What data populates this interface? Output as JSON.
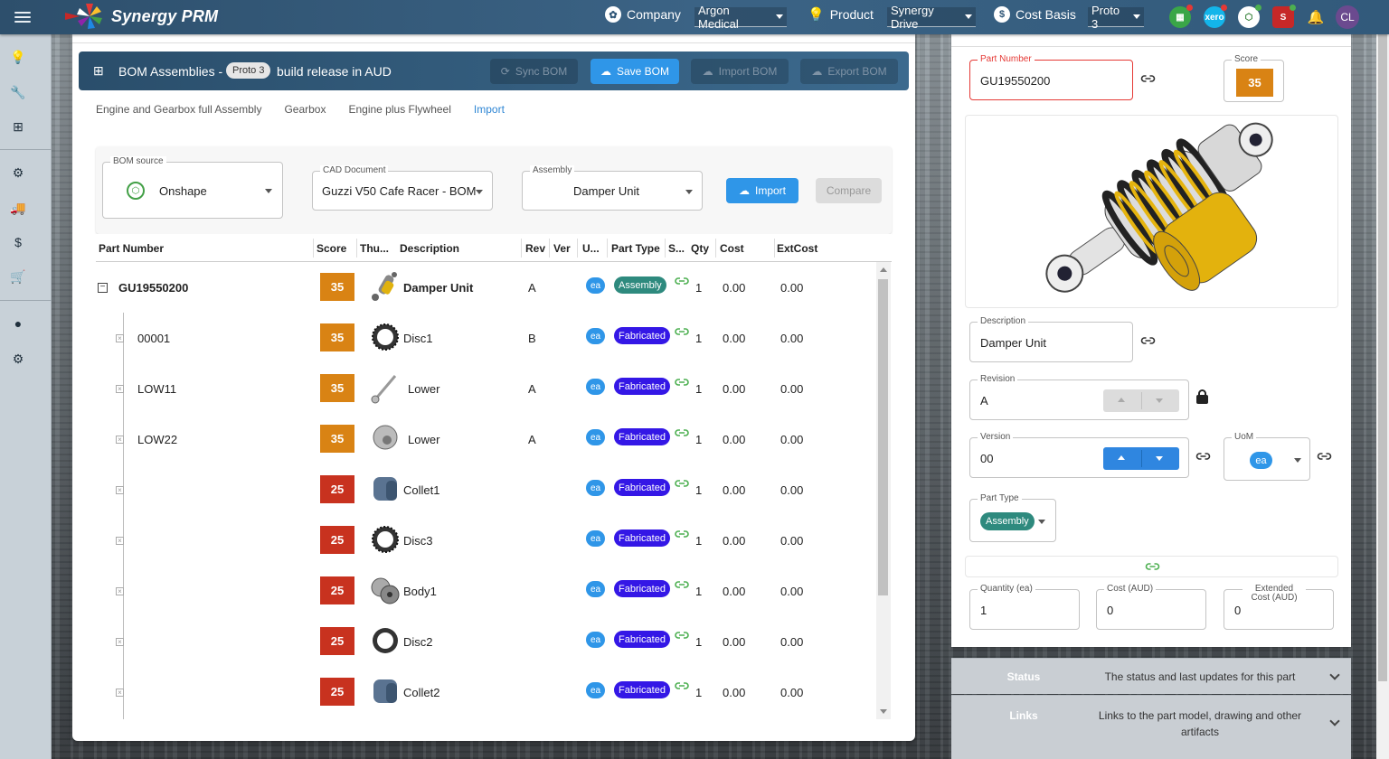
{
  "app": {
    "brand": "Synergy PRM",
    "avatar": "CL"
  },
  "topnav": {
    "company_label": "Company",
    "company_value": "Argon Medical",
    "product_label": "Product",
    "product_value": "Synergy Drive",
    "cost_label": "Cost Basis",
    "cost_value": "Proto 3",
    "xero": "xero"
  },
  "bom": {
    "title": "BOM Assemblies -",
    "badge": "Proto 3",
    "release": "build release in AUD",
    "sync": "Sync BOM",
    "save": "Save BOM",
    "import": "Import BOM",
    "export": "Export BOM"
  },
  "tabs": [
    "Engine and Gearbox full Assembly",
    "Gearbox",
    "Engine plus Flywheel",
    "Import"
  ],
  "source": {
    "bom_source_label": "BOM source",
    "bom_source_value": "Onshape",
    "cad_label": "CAD Document",
    "cad_value": "Guzzi V50 Cafe Racer - BOM",
    "assembly_label": "Assembly",
    "assembly_value": "Damper Unit",
    "import_btn": "Import",
    "compare_btn": "Compare"
  },
  "columns": [
    "Part Number",
    "Score",
    "Thu...",
    "Description",
    "Rev",
    "Ver",
    "U...",
    "Part Type",
    "S...",
    "Qty",
    "Cost",
    "ExtCost"
  ],
  "rows": [
    {
      "pn": "GU19550200",
      "score": "35",
      "desc": "Damper Unit",
      "rev": "A",
      "uom": "ea",
      "type": "Assembly",
      "qty": "1",
      "cost": "0.00",
      "ext": "0.00"
    },
    {
      "pn": "00001",
      "score": "35",
      "desc": "Disc1",
      "rev": "B",
      "uom": "ea",
      "type": "Fabricated",
      "qty": "1",
      "cost": "0.00",
      "ext": "0.00"
    },
    {
      "pn": "LOW11",
      "score": "35",
      "desc": "Lower",
      "rev": "A",
      "uom": "ea",
      "type": "Fabricated",
      "qty": "1",
      "cost": "0.00",
      "ext": "0.00"
    },
    {
      "pn": "LOW22",
      "score": "35",
      "desc": "Lower",
      "rev": "A",
      "uom": "ea",
      "type": "Fabricated",
      "qty": "1",
      "cost": "0.00",
      "ext": "0.00"
    },
    {
      "pn": "",
      "score": "25",
      "desc": "Collet1",
      "rev": "",
      "uom": "ea",
      "type": "Fabricated",
      "qty": "1",
      "cost": "0.00",
      "ext": "0.00"
    },
    {
      "pn": "",
      "score": "25",
      "desc": "Disc3",
      "rev": "",
      "uom": "ea",
      "type": "Fabricated",
      "qty": "1",
      "cost": "0.00",
      "ext": "0.00"
    },
    {
      "pn": "",
      "score": "25",
      "desc": "Body1",
      "rev": "",
      "uom": "ea",
      "type": "Fabricated",
      "qty": "1",
      "cost": "0.00",
      "ext": "0.00"
    },
    {
      "pn": "",
      "score": "25",
      "desc": "Disc2",
      "rev": "",
      "uom": "ea",
      "type": "Fabricated",
      "qty": "1",
      "cost": "0.00",
      "ext": "0.00"
    },
    {
      "pn": "",
      "score": "25",
      "desc": "Collet2",
      "rev": "",
      "uom": "ea",
      "type": "Fabricated",
      "qty": "1",
      "cost": "0.00",
      "ext": "0.00"
    }
  ],
  "detail": {
    "part_number_label": "Part Number",
    "part_number": "GU19550200",
    "score_label": "Score",
    "score": "35",
    "description_label": "Description",
    "description": "Damper Unit",
    "revision_label": "Revision",
    "revision": "A",
    "version_label": "Version",
    "version": "00",
    "uom_label": "UoM",
    "uom": "ea",
    "part_type_label": "Part Type",
    "part_type": "Assembly",
    "qty_label": "Quantity (ea)",
    "qty": "1",
    "cost_label": "Cost (AUD)",
    "cost": "0",
    "ext_label": "Extended Cost (AUD)",
    "ext": "0"
  },
  "accordions": [
    {
      "key": "Status",
      "text": "The status and last updates for this part"
    },
    {
      "key": "Links",
      "text": "Links to the part model, drawing and other artifacts"
    }
  ],
  "colors": {
    "score35": "#d98314",
    "score25": "#c8321f",
    "assembly": "#2e8a7e",
    "fabricated": "#3417e6",
    "accent": "#2f96e8"
  }
}
